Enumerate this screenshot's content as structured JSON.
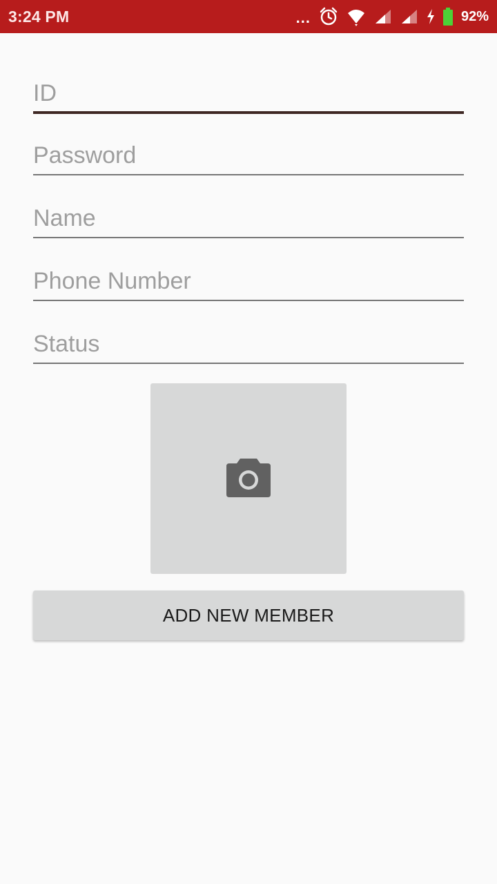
{
  "status_bar": {
    "time": "3:24 PM",
    "more_dots": "...",
    "battery_percent": "92%",
    "icons": [
      "alarm-icon",
      "wifi-icon",
      "signal-icon",
      "signal-icon",
      "charging-icon",
      "battery-icon"
    ]
  },
  "form": {
    "fields": [
      {
        "placeholder": "ID",
        "value": ""
      },
      {
        "placeholder": "Password",
        "value": ""
      },
      {
        "placeholder": "Name",
        "value": ""
      },
      {
        "placeholder": "Phone Number",
        "value": ""
      },
      {
        "placeholder": "Status",
        "value": ""
      }
    ],
    "photo_icon": "camera-icon",
    "submit_label": "ADD NEW MEMBER"
  },
  "colors": {
    "status_bar": "#b71c1c",
    "background": "#fafafa",
    "focused_underline": "#3e2723",
    "placeholder": "#9e9e9e",
    "button_bg": "#d7d8d8",
    "battery": "#4cd137"
  }
}
